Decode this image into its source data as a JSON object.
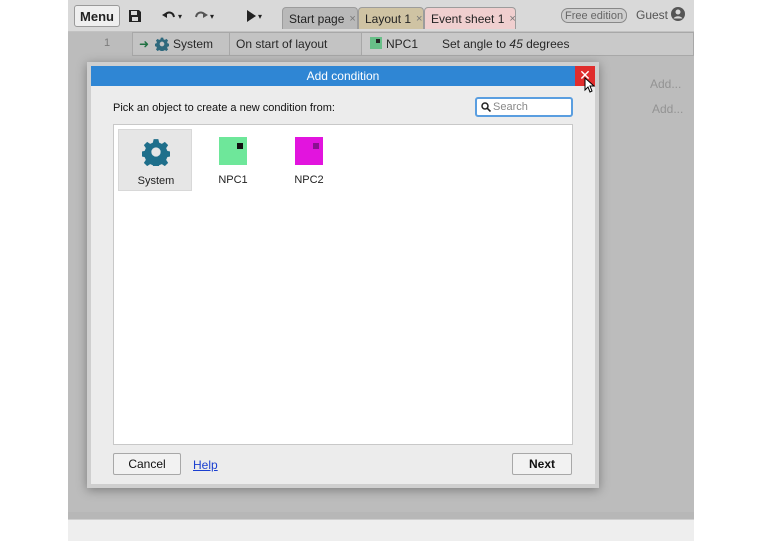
{
  "toolbar": {
    "menu_label": "Menu",
    "icons": [
      "save-icon",
      "undo-icon",
      "redo-icon",
      "play-icon"
    ]
  },
  "tabs": [
    {
      "label": "Start page",
      "close": "×",
      "color": "#b9b9b9"
    },
    {
      "label": "Layout 1",
      "close": "×",
      "color": "#cfc3a3"
    },
    {
      "label": "Event sheet 1",
      "close": "×",
      "color": "#f0cfcf"
    }
  ],
  "account": {
    "edition_badge": "Free edition",
    "user_label": "Guest"
  },
  "event_sheet": {
    "row_number": "1",
    "event": {
      "object": "System",
      "condition": "On start of layout"
    },
    "action": {
      "object": "NPC1",
      "text_prefix": "Set angle to ",
      "value": "45",
      "text_suffix": " degrees"
    },
    "add_link_1": "Add...",
    "add_link_2": "Add..."
  },
  "dialog": {
    "title": "Add condition",
    "close_glyph": "✕",
    "prompt": "Pick an object to create a new condition from:",
    "search": {
      "placeholder": "Search",
      "value": ""
    },
    "objects": [
      {
        "label": "System",
        "icon": "gear-icon",
        "selected": true
      },
      {
        "label": "NPC1",
        "icon": "npc1-swatch-icon",
        "color": "#6ee79a",
        "selected": false
      },
      {
        "label": "NPC2",
        "icon": "npc2-swatch-icon",
        "color": "#e214de",
        "selected": false
      }
    ],
    "cancel_label": "Cancel",
    "help_label": "Help",
    "next_label": "Next"
  },
  "colors": {
    "title_bar": "#2f86d4",
    "close_button": "#e02d2d",
    "link": "#1a3fd0"
  }
}
